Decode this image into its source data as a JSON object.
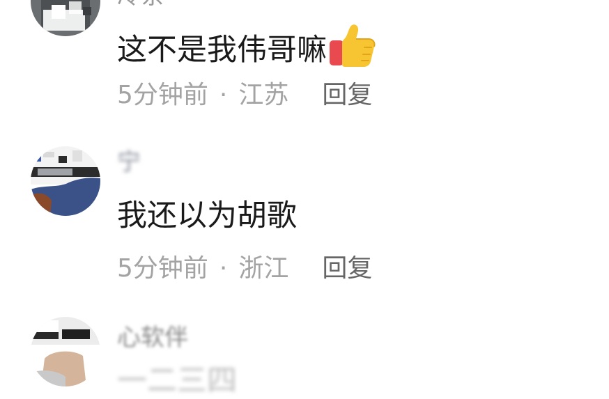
{
  "comments": [
    {
      "username": "冷茶",
      "content": "这不是我伟哥嘛",
      "emoji": "thumbs-up-icon",
      "time": "5分钟前",
      "separator": "·",
      "location": "江苏",
      "reply_label": "回复"
    },
    {
      "username": "宁",
      "content": "我还以为胡歌",
      "time": "5分钟前",
      "separator": "·",
      "location": "浙江",
      "reply_label": "回复"
    },
    {
      "username": "心软伴",
      "content": "一二三四"
    }
  ],
  "colors": {
    "content_text": "#1a1a1a",
    "meta_text": "#a3a3a3",
    "reply_text": "#666666",
    "username_text": "#9a9a9a"
  }
}
